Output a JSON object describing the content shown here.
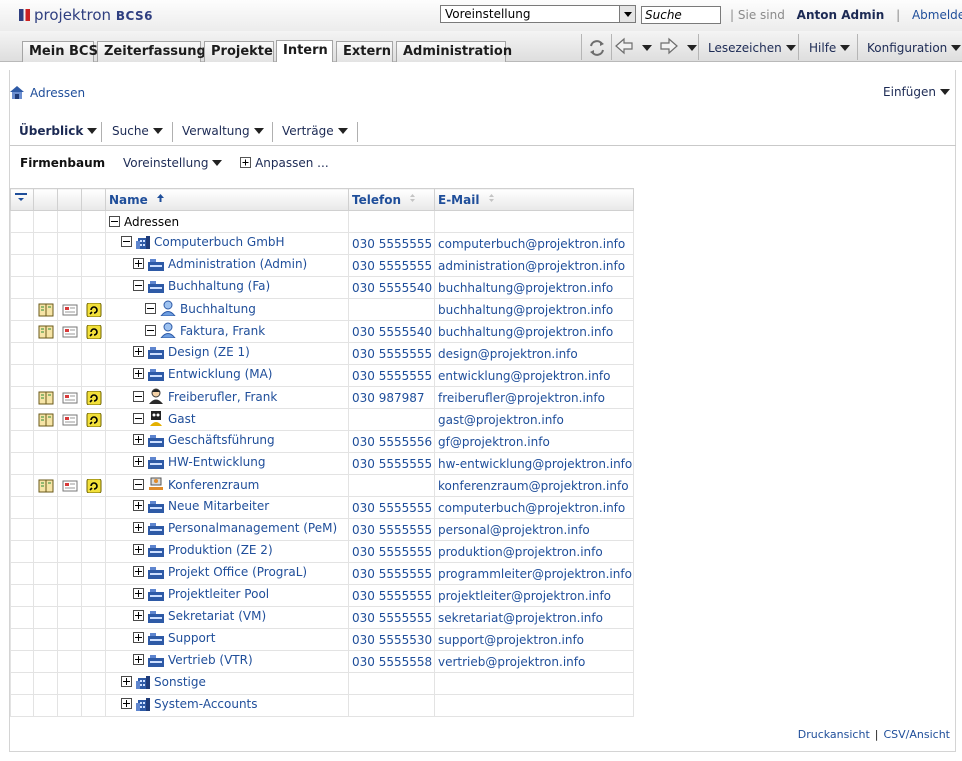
{
  "app": {
    "logo_text": "projektron",
    "logo_product": "BCS",
    "logo_version": "6"
  },
  "header": {
    "preset_value": "Voreinstellung",
    "search_placeholder": "Suche",
    "logged_in_label": "Sie sind",
    "user_name": "Anton Admin",
    "logout_label": "Abmelden"
  },
  "tabs": [
    {
      "label": "Mein BCS",
      "active": false
    },
    {
      "label": "Zeiterfassung",
      "active": false
    },
    {
      "label": "Projekte",
      "active": false
    },
    {
      "label": "Intern",
      "active": true
    },
    {
      "label": "Extern",
      "active": false
    },
    {
      "label": "Administration",
      "active": false
    }
  ],
  "top_menus": {
    "bookmarks": "Lesezeichen",
    "help": "Hilfe",
    "config": "Konfiguration"
  },
  "breadcrumb": {
    "label": "Adressen"
  },
  "insert_menu": "Einfügen",
  "submenu": {
    "overview": "Überblick",
    "search": "Suche",
    "admin": "Verwaltung",
    "contracts": "Verträge"
  },
  "viewbar": {
    "title": "Firmenbaum",
    "preset": "Voreinstellung",
    "customize": "Anpassen ..."
  },
  "grid": {
    "headers": {
      "name": "Name",
      "phone": "Telefon",
      "email": "E-Mail"
    },
    "rows": [
      {
        "level": 0,
        "toggle": "minus",
        "icon": "none",
        "name": "Adressen",
        "phone": "",
        "email": "",
        "actions": false,
        "root": true
      },
      {
        "level": 1,
        "toggle": "minus",
        "icon": "company",
        "name": "Computerbuch GmbH",
        "phone": "030 5555555",
        "email": "computerbuch@projektron.info",
        "actions": false
      },
      {
        "level": 2,
        "toggle": "plus",
        "icon": "dept",
        "name": "Administration (Admin)",
        "phone": "030 5555555",
        "email": "administration@projektron.info",
        "actions": false
      },
      {
        "level": 2,
        "toggle": "minus",
        "icon": "dept",
        "name": "Buchhaltung (Fa)",
        "phone": "030 5555540",
        "email": "buchhaltung@projektron.info",
        "actions": false
      },
      {
        "level": 3,
        "toggle": "minus",
        "icon": "person-blue",
        "name": "Buchhaltung",
        "phone": "",
        "email": "buchhaltung@projektron.info",
        "actions": true
      },
      {
        "level": 3,
        "toggle": "minus",
        "icon": "person-blue",
        "name": "Faktura, Frank",
        "phone": "030 5555540",
        "email": "buchhaltung@projektron.info",
        "actions": true
      },
      {
        "level": 2,
        "toggle": "plus",
        "icon": "dept",
        "name": "Design (ZE 1)",
        "phone": "030 5555555",
        "email": "design@projektron.info",
        "actions": false
      },
      {
        "level": 2,
        "toggle": "plus",
        "icon": "dept",
        "name": "Entwicklung (MA)",
        "phone": "030 5555555",
        "email": "entwicklung@projektron.info",
        "actions": false
      },
      {
        "level": 2,
        "toggle": "minus",
        "icon": "person-dark",
        "name": "Freiberufler, Frank",
        "phone": "030 987987",
        "email": "freiberufler@projektron.info",
        "actions": true
      },
      {
        "level": 2,
        "toggle": "minus",
        "icon": "guest",
        "name": "Gast",
        "phone": "",
        "email": "gast@projektron.info",
        "actions": true
      },
      {
        "level": 2,
        "toggle": "plus",
        "icon": "dept",
        "name": "Geschäftsführung",
        "phone": "030 5555556",
        "email": "gf@projektron.info",
        "actions": false
      },
      {
        "level": 2,
        "toggle": "plus",
        "icon": "dept",
        "name": "HW-Entwicklung",
        "phone": "030 5555555",
        "email": "hw-entwicklung@projektron.info",
        "actions": false
      },
      {
        "level": 2,
        "toggle": "minus",
        "icon": "room",
        "name": "Konferenzraum",
        "phone": "",
        "email": "konferenzraum@projektron.info",
        "actions": true
      },
      {
        "level": 2,
        "toggle": "plus",
        "icon": "dept",
        "name": "Neue Mitarbeiter",
        "phone": "030 5555555",
        "email": "computerbuch@projektron.info",
        "actions": false
      },
      {
        "level": 2,
        "toggle": "plus",
        "icon": "dept",
        "name": "Personalmanagement (PeM)",
        "phone": "030 5555555",
        "email": "personal@projektron.info",
        "actions": false
      },
      {
        "level": 2,
        "toggle": "plus",
        "icon": "dept",
        "name": "Produktion (ZE 2)",
        "phone": "030 5555555",
        "email": "produktion@projektron.info",
        "actions": false
      },
      {
        "level": 2,
        "toggle": "plus",
        "icon": "dept",
        "name": "Projekt Office (PrograL)",
        "phone": "030 5555555",
        "email": "programmleiter@projektron.info",
        "actions": false
      },
      {
        "level": 2,
        "toggle": "plus",
        "icon": "dept",
        "name": "Projektleiter Pool",
        "phone": "030 5555555",
        "email": "projektleiter@projektron.info",
        "actions": false
      },
      {
        "level": 2,
        "toggle": "plus",
        "icon": "dept",
        "name": "Sekretariat (VM)",
        "phone": "030 5555555",
        "email": "sekretariat@projektron.info",
        "actions": false
      },
      {
        "level": 2,
        "toggle": "plus",
        "icon": "dept",
        "name": "Support",
        "phone": "030 5555530",
        "email": "support@projektron.info",
        "actions": false
      },
      {
        "level": 2,
        "toggle": "plus",
        "icon": "dept",
        "name": "Vertrieb (VTR)",
        "phone": "030 5555558",
        "email": "vertrieb@projektron.info",
        "actions": false
      },
      {
        "level": 1,
        "toggle": "plus",
        "icon": "company",
        "name": "Sonstige",
        "phone": "",
        "email": "",
        "actions": false
      },
      {
        "level": 1,
        "toggle": "plus",
        "icon": "company",
        "name": "System-Accounts",
        "phone": "",
        "email": "",
        "actions": false
      }
    ]
  },
  "footer": {
    "print": "Druckansicht",
    "csv": "CSV/Ansicht"
  },
  "colors": {
    "link": "#1f4e9a",
    "text": "#1c2a54"
  }
}
